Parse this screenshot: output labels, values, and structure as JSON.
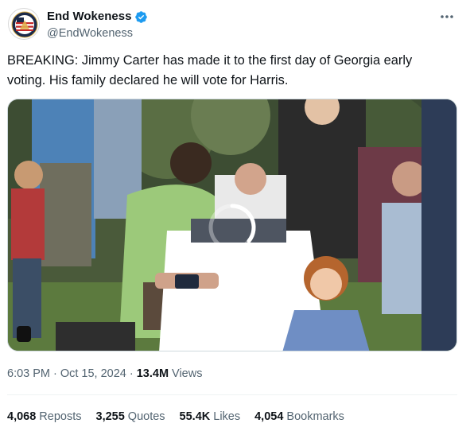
{
  "author": {
    "display_name": "End Wokeness",
    "handle": "@EndWokeness",
    "verified_icon": "verified-badge-icon",
    "verified_color": "#1d9bf0"
  },
  "tweet": {
    "text": "BREAKING: Jimmy Carter has made it to the first day of Georgia early voting. His family declared he will vote for Harris."
  },
  "meta": {
    "time": "6:03 PM",
    "separator": "·",
    "date": "Oct 15, 2024",
    "views_count": "13.4M",
    "views_label": "Views"
  },
  "stats": [
    {
      "count": "4,068",
      "label": "Reposts"
    },
    {
      "count": "3,255",
      "label": "Quotes"
    },
    {
      "count": "55.4K",
      "label": "Likes"
    },
    {
      "count": "4,054",
      "label": "Bookmarks"
    }
  ],
  "colors": {
    "text_primary": "#0f1419",
    "text_secondary": "#536471",
    "border": "#cfd9de",
    "divider": "#eff3f4"
  }
}
